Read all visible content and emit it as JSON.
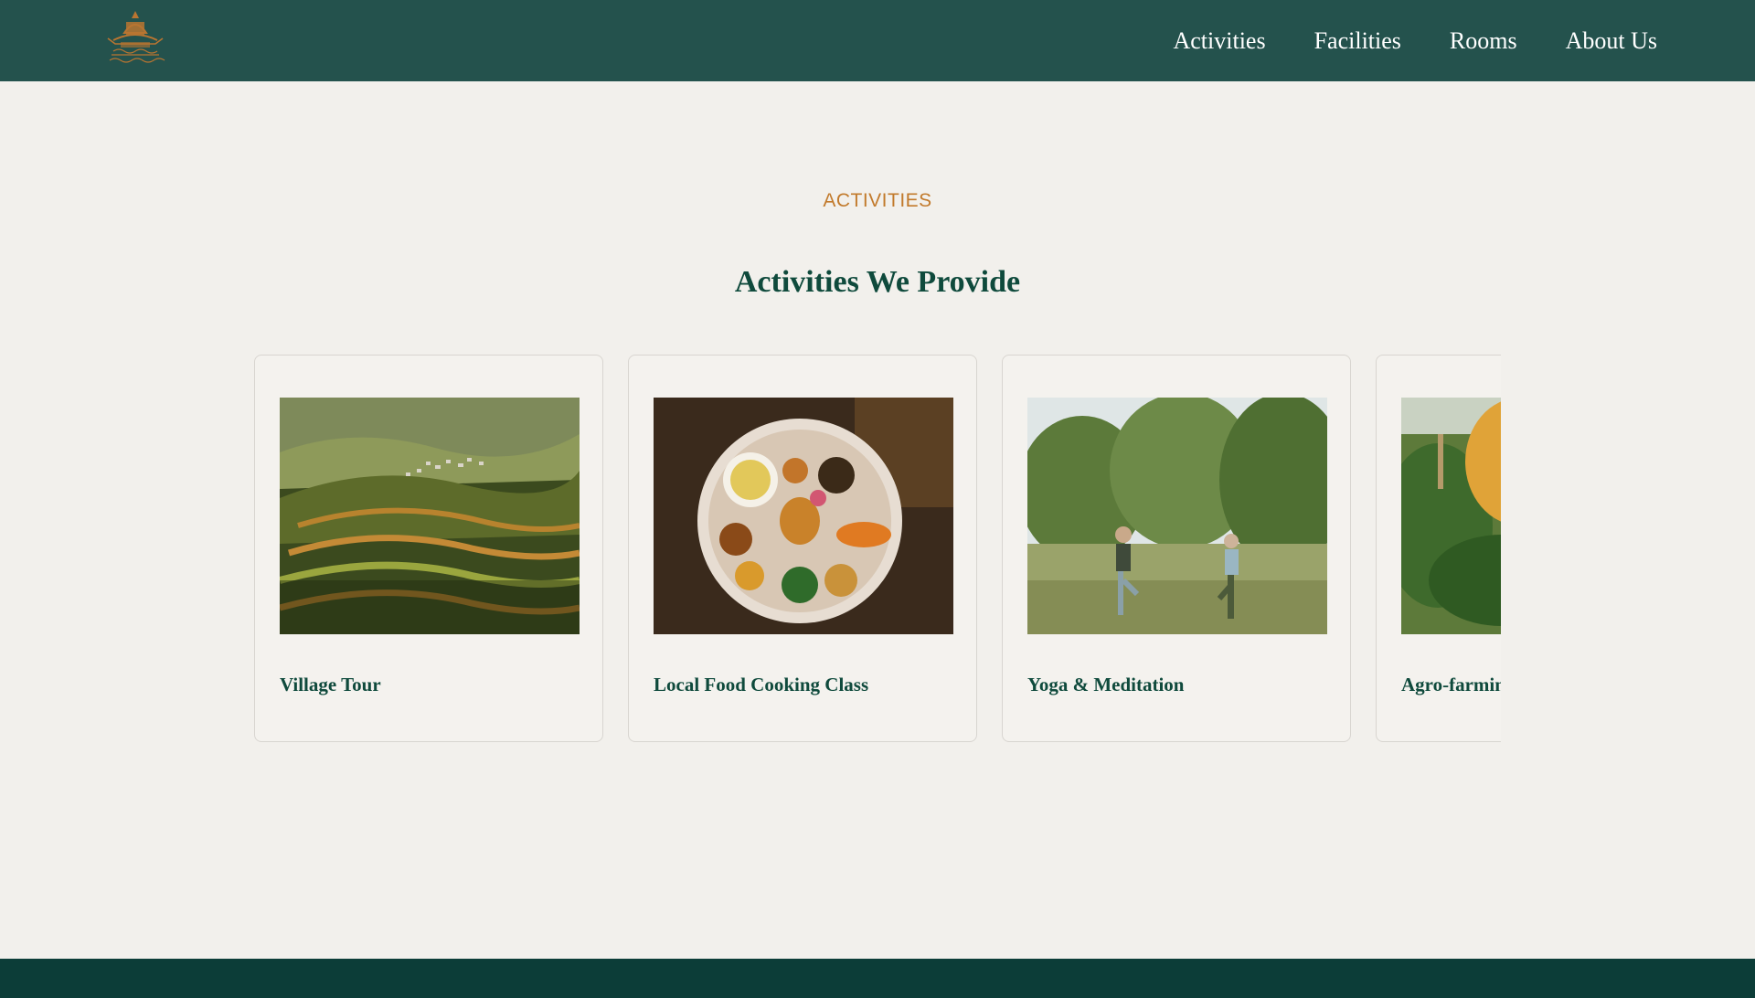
{
  "header": {
    "logo_alt": "Site logo",
    "nav": [
      "Activities",
      "Facilities",
      "Rooms",
      "About Us"
    ]
  },
  "section": {
    "eyebrow": "ACTIVITIES",
    "title": "Activities We Provide"
  },
  "cards": [
    {
      "title": "Village Tour",
      "image": "terraced-hills-photo"
    },
    {
      "title": "Local Food Cooking Class",
      "image": "food-plate-photo"
    },
    {
      "title": "Yoga & Meditation",
      "image": "yoga-park-photo"
    },
    {
      "title": "Agro-farming",
      "image": "farming-photo"
    }
  ],
  "colors": {
    "header_bg": "#24524d",
    "page_bg": "#f2f0ec",
    "accent": "#c27a2c",
    "heading": "#0f4a3c",
    "footer_bg": "#0c3d38"
  }
}
